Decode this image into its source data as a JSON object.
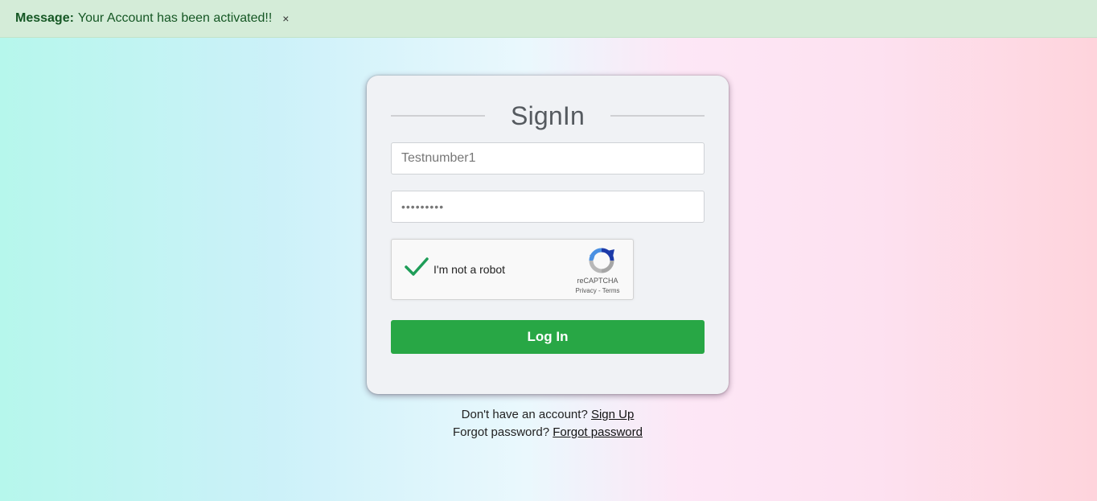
{
  "alert": {
    "label": "Message:",
    "text": "Your Account has been activated!!",
    "close": "×"
  },
  "signin": {
    "title": "SignIn",
    "username_value": "Testnumber1",
    "password_value": "•••••••••",
    "captcha": {
      "label": "I'm not a robot",
      "brand": "reCAPTCHA",
      "privacy": "Privacy",
      "separator": " - ",
      "terms": "Terms",
      "checked": true
    },
    "login_label": "Log In"
  },
  "footer": {
    "signup_prompt": "Don't have an account?",
    "signup_link": "Sign Up",
    "forgot_prompt": "Forgot password?",
    "forgot_link": "Forgot password"
  },
  "colors": {
    "success_green": "#28a745",
    "alert_bg": "#d4ecd8",
    "alert_text": "#155724",
    "check_green": "#1e9d58"
  }
}
